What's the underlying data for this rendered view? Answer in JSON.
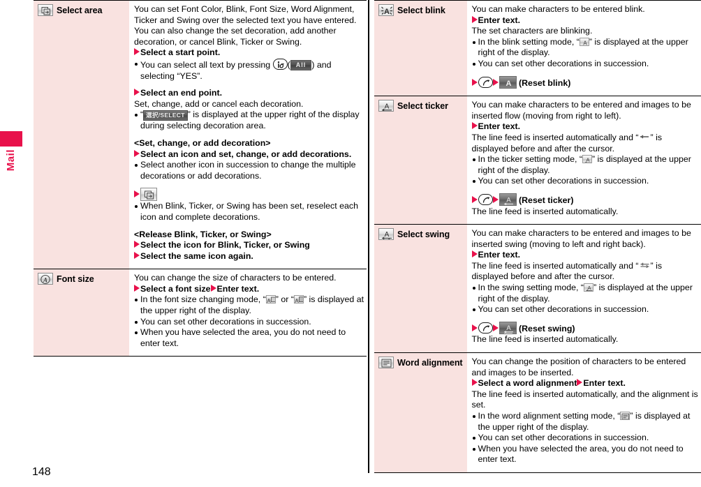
{
  "page": {
    "number": "148",
    "index_tab": "Mail"
  },
  "left_column": {
    "rows": [
      {
        "icon": "select-area-icon",
        "title": "Select area",
        "intro": "You can set Font Color, Blink, Font Size, Word Alignment, Ticker and Swing over the selected text you have entered. You can also change the set decoration, add another decoration, or cancel Blink, Ticker or Swing.",
        "step1": "Select a start point.",
        "bullet1_a": "You can select all text by pressing",
        "bullet1_key": "imode-key",
        "bullet1_softkey": "All",
        "bullet1_b": ") and selecting “YES”.",
        "step2": "Select an end point.",
        "after_step2": "Set, change, add or cancel each decoration.",
        "bullet2_pre": "“",
        "bullet2_badge": "選択/SELECT",
        "bullet2_post": "” is displayed at the upper right of the display during selecting decoration area.",
        "subhead1": "<Set, change, or add decoration>",
        "step3": "Select an icon and set, change, or add decorations.",
        "bullet3": "Select another icon in succession to change the multiple decorations or add decorations.",
        "step4_icon": "select-area-icon",
        "bullet4": "When Blink, Ticker, or Swing has been set, reselect each icon and complete decorations.",
        "subhead2": "<Release Blink, Ticker, or Swing>",
        "step5": "Select the icon for Blink, Ticker, or Swing",
        "step6": "Select the same icon again."
      },
      {
        "icon": "font-size-icon",
        "title": "Font size",
        "intro": "You can change the size of characters to be entered.",
        "step1": "Select a font size",
        "step1b": "Enter text.",
        "bullet1_pre": "In the font size changing mode, “",
        "bullet1_mid": "” or “",
        "bullet1_post": "” is displayed at the upper right of the display.",
        "bullet2": "You can set other decorations in succession.",
        "bullet3": "When you have selected the area, you do not need to enter text."
      }
    ]
  },
  "right_column": {
    "rows": [
      {
        "icon": "select-blink-icon",
        "title": "Select blink",
        "intro": "You can make characters to be entered blink.",
        "step1": "Enter text.",
        "after_step1": "The set characters are blinking.",
        "bullet1_pre": "In the blink setting mode, “",
        "bullet1_post": "” is displayed at the upper right of the display.",
        "bullet2": "You can set other decorations in succession.",
        "reset_key": "call-key",
        "reset_label": "(Reset blink)"
      },
      {
        "icon": "select-ticker-icon",
        "title": "Select ticker",
        "intro": "You can make characters to be entered and images to be inserted flow (moving from right to left).",
        "step1": "Enter text.",
        "after_step1_pre": "The line feed is inserted automatically and “",
        "after_step1_post": "” is displayed before and after the cursor.",
        "bullet1_pre": "In the ticker setting mode, “",
        "bullet1_post": "” is displayed at the upper right of the display.",
        "bullet2": "You can set other decorations in succession.",
        "reset_key": "call-key",
        "reset_label": "(Reset ticker)",
        "footer": "The line feed is inserted automatically."
      },
      {
        "icon": "select-swing-icon",
        "title": "Select swing",
        "intro": "You can make characters to be entered and images to be inserted swing (moving to left and right back).",
        "step1": "Enter text.",
        "after_step1_pre": "The line feed is inserted automatically and “",
        "after_step1_post": "” is displayed before and after the cursor.",
        "bullet1_pre": "In the swing setting mode, “",
        "bullet1_post": "” is displayed at the upper right of the display.",
        "bullet2": "You can set other decorations in succession.",
        "reset_key": "call-key",
        "reset_label": "(Reset swing)",
        "footer": "The line feed is inserted automatically."
      },
      {
        "icon": "word-alignment-icon",
        "title": "Word alignment",
        "intro": "You can change the position of characters to be entered and images to be inserted.",
        "step1": "Select a word alignment",
        "step1b": "Enter text.",
        "after_step1": "The line feed is inserted automatically, and the alignment is set.",
        "bullet1_pre": "In the word alignment setting mode, “",
        "bullet1_post": "” is displayed at the upper right of the display.",
        "bullet2": "You can set other decorations in succession.",
        "bullet3": "When you have selected the area, you do not need to enter text."
      }
    ]
  },
  "colors": {
    "accent": "#e8114b",
    "cell_head_bg": "#f9e2e0",
    "rule": "#000000"
  }
}
